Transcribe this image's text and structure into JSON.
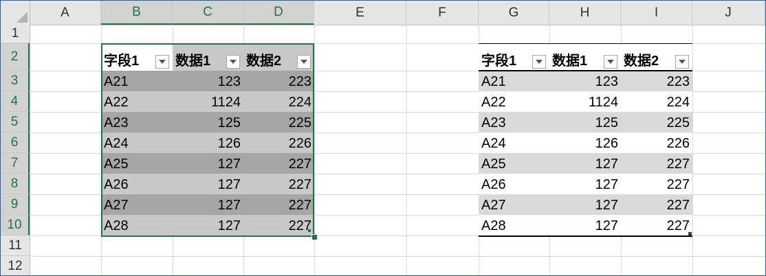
{
  "columns": [
    "A",
    "B",
    "C",
    "D",
    "E",
    "F",
    "G",
    "H",
    "I",
    "J"
  ],
  "rows": [
    "1",
    "2",
    "3",
    "4",
    "5",
    "6",
    "7",
    "8",
    "9",
    "10",
    "11",
    "12"
  ],
  "left_table": {
    "headers": [
      "字段1",
      "数据1",
      "数据2"
    ],
    "rows": [
      [
        "A21",
        "123",
        "223"
      ],
      [
        "A22",
        "1124",
        "224"
      ],
      [
        "A23",
        "125",
        "225"
      ],
      [
        "A24",
        "126",
        "226"
      ],
      [
        "A25",
        "127",
        "227"
      ],
      [
        "A26",
        "127",
        "227"
      ],
      [
        "A27",
        "127",
        "227"
      ],
      [
        "A28",
        "127",
        "227"
      ]
    ]
  },
  "right_table": {
    "headers": [
      "字段1",
      "数据1",
      "数据2"
    ],
    "rows": [
      [
        "A21",
        "123",
        "223"
      ],
      [
        "A22",
        "1124",
        "224"
      ],
      [
        "A23",
        "125",
        "225"
      ],
      [
        "A24",
        "126",
        "226"
      ],
      [
        "A25",
        "127",
        "227"
      ],
      [
        "A26",
        "127",
        "227"
      ],
      [
        "A27",
        "127",
        "227"
      ],
      [
        "A28",
        "127",
        "227"
      ]
    ]
  },
  "colors": {
    "selection_accent": "#217346",
    "left_band_dark": "#a6a6a6",
    "left_band_light": "#c8c8c8",
    "right_band": "#d9d9d9"
  }
}
